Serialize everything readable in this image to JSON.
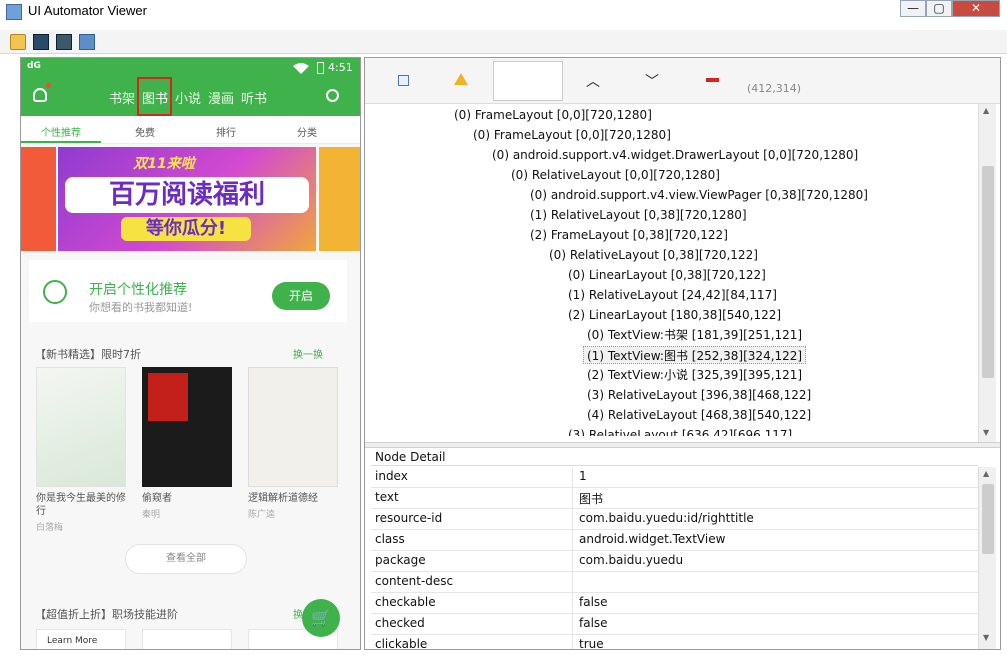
{
  "window": {
    "title": "UI Automator Viewer",
    "min": "—",
    "max": "▢",
    "close": "✕"
  },
  "device": {
    "status": {
      "carrier": "dG",
      "time": "4:51"
    },
    "tabs": [
      "书架",
      "图书",
      "小说",
      "漫画",
      "听书"
    ],
    "active_tab": "图书",
    "subtabs": [
      "个性推荐",
      "免费",
      "排行",
      "分类"
    ],
    "banner": {
      "line1": "双11来啦",
      "line2": "百万阅读福利",
      "line3": "等你瓜分!"
    },
    "rec": {
      "title": "开启个性化推荐",
      "subtitle": "你想看的书我都知道!",
      "button": "开启"
    },
    "section1": {
      "title": "【新书精选】限时7折",
      "more": "换一换"
    },
    "books": [
      {
        "title": "你是我今生最美的修行",
        "author": "白落梅"
      },
      {
        "title": "偷窥者",
        "author": "秦明"
      },
      {
        "title": "逻辑解析道德经",
        "author": "陈广逵"
      }
    ],
    "view_all": "查看全部",
    "section2": {
      "title": "【超值折上折】职场技能进阶",
      "more": "换"
    },
    "mini1": "Learn More"
  },
  "toolbar": {
    "coord": "(412,314)"
  },
  "tree": [
    "(0) FrameLayout [0,0][720,1280]",
    "(0) FrameLayout [0,0][720,1280]",
    "(0) android.support.v4.widget.DrawerLayout [0,0][720,1280]",
    "(0) RelativeLayout [0,0][720,1280]",
    "(0) android.support.v4.view.ViewPager [0,38][720,1280]",
    "(1) RelativeLayout [0,38][720,1280]",
    "(2) FrameLayout [0,38][720,122]",
    "(0) RelativeLayout [0,38][720,122]",
    "(0) LinearLayout [0,38][720,122]",
    "(1) RelativeLayout [24,42][84,117]",
    "(2) LinearLayout [180,38][540,122]",
    "(0) TextView:书架 [181,39][251,121]",
    "(1) TextView:图书 [252,38][324,122]",
    "(2) TextView:小说 [325,39][395,121]",
    "(3) RelativeLayout [396,38][468,122]",
    "(4) RelativeLayout [468,38][540,122]",
    "(3) RelativeLayout [636,42][696,117]"
  ],
  "node_detail": {
    "title": "Node Detail",
    "rows": [
      {
        "key": "index",
        "value": "1"
      },
      {
        "key": "text",
        "value": "图书"
      },
      {
        "key": "resource-id",
        "value": "com.baidu.yuedu:id/righttitle"
      },
      {
        "key": "class",
        "value": "android.widget.TextView"
      },
      {
        "key": "package",
        "value": "com.baidu.yuedu"
      },
      {
        "key": "content-desc",
        "value": ""
      },
      {
        "key": "checkable",
        "value": "false"
      },
      {
        "key": "checked",
        "value": "false"
      },
      {
        "key": "clickable",
        "value": "true"
      }
    ]
  }
}
